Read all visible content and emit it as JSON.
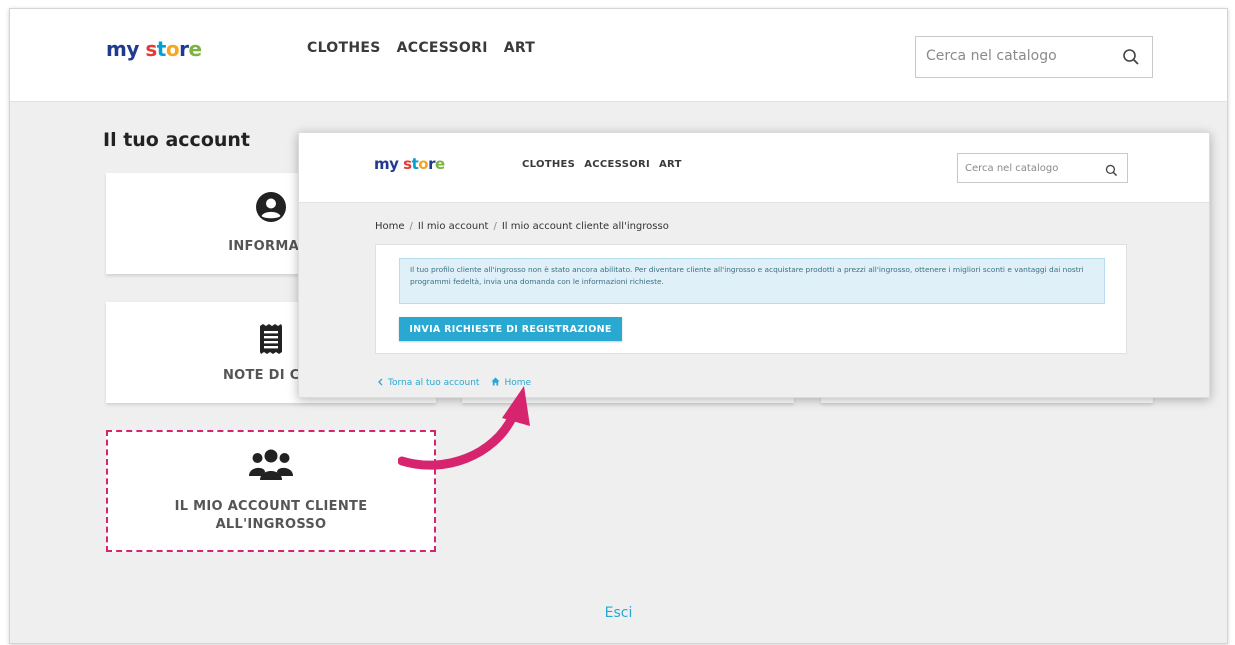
{
  "store": {
    "logo": {
      "my": "my",
      "store_letters": [
        "s",
        "t",
        "o",
        "r",
        "e"
      ]
    },
    "nav": [
      "CLOTHES",
      "ACCESSORI",
      "ART"
    ],
    "search_placeholder": "Cerca nel catalogo"
  },
  "account": {
    "title": "Il tuo account",
    "cards": [
      {
        "label": "INFORMAZI",
        "icon": "user-circle-icon"
      },
      {
        "label": "NOTE DI CRE",
        "icon": "receipt-icon"
      },
      {
        "label": "IL MIO ACCOUNT CLIENTE ALL'INGROSSO",
        "icon": "users-group-icon"
      }
    ],
    "logout": "Esci"
  },
  "wholesale_page": {
    "breadcrumb": [
      "Home",
      "Il mio account",
      "Il mio account cliente all'ingrosso"
    ],
    "alert": "Il tuo profilo cliente all'ingrosso non è stato ancora abilitato. Per diventare cliente all'ingrosso e acquistare prodotti a prezzi all'ingrosso, ottenere i migliori sconti e vantaggi dai nostri programmi fedeltà, invia una domanda con le informazioni richieste.",
    "register_button": "INVIA RICHIESTE DI REGISTRAZIONE",
    "back_link": "Torna al tuo account",
    "home_link": "Home"
  },
  "colors": {
    "accent": "#29a8d2",
    "highlight": "#d6246e",
    "alert_bg": "#dff0f8",
    "page_bg": "#efefef"
  }
}
